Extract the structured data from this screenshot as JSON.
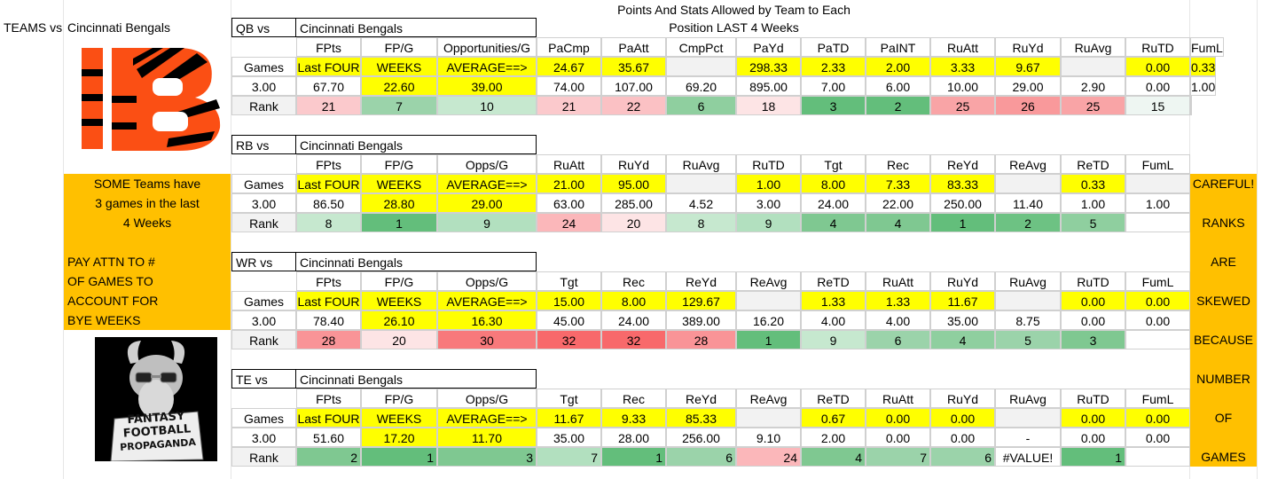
{
  "header": {
    "teams_vs": "TEAMS vs",
    "team_name": "Cincinnati Bengals",
    "title_line1": "Points And Stats Allowed by Team to Each",
    "title_line2": "Position LAST  4 Weeks"
  },
  "left_note": {
    "lines": [
      "SOME Teams have",
      "3 games in the last",
      "4 Weeks",
      "",
      "PAY ATTN TO #",
      "OF GAMES TO",
      "ACCOUNT FOR",
      "BYE WEEKS"
    ]
  },
  "right_note": {
    "words": [
      "CAREFUL!",
      "RANKS",
      "ARE",
      "SKEWED",
      "BECAUSE",
      "NUMBER",
      "OF",
      "GAMES"
    ]
  },
  "logo": {
    "bengals_logo_text": "B",
    "goat_logo_text": [
      "FANTASY",
      "FOOTBALL",
      "PROPAGANDA"
    ]
  },
  "colors": {
    "yellow": "#ffff00",
    "orange": "#ffc000",
    "bengals_orange": "#fb4f14",
    "rank_dark_green": "#63be7b",
    "rank_light_green": "#c6e8cf",
    "rank_pink": "#fbc9cc",
    "rank_red": "#f8696b"
  },
  "sections": [
    {
      "label": "QB vs",
      "team": "Cincinnati Bengals",
      "headers": [
        "FPts",
        "FP/G",
        "Opportunities/G",
        "PaCmp",
        "PaAtt",
        "CmpPct",
        "PaYd",
        "PaTD",
        "PaINT",
        "RuAtt",
        "RuYd",
        "RuAvg",
        "RuTD",
        "FumL"
      ],
      "games_label": "Games",
      "averages": [
        "Last FOUR",
        "WEEKS",
        "AVERAGE==>",
        "24.67",
        "35.67",
        "",
        "298.33",
        "2.33",
        "2.00",
        "3.33",
        "9.67",
        "",
        "0.00",
        "0.33"
      ],
      "num_games": "3.00",
      "totals": [
        "67.70",
        "22.60",
        "39.00",
        "74.00",
        "107.00",
        "69.20",
        "895.00",
        "7.00",
        "6.00",
        "10.00",
        "29.00",
        "2.90",
        "0.00",
        "1.00"
      ],
      "rank_label": "Rank",
      "ranks": [
        "21",
        "7",
        "10",
        "21",
        "22",
        "6",
        "18",
        "3",
        "2",
        "25",
        "26",
        "25",
        "15",
        ""
      ]
    },
    {
      "label": "RB vs",
      "team": "Cincinnati Bengals",
      "headers": [
        "FPts",
        "FP/G",
        "Opps/G",
        "RuAtt",
        "RuYd",
        "RuAvg",
        "RuTD",
        "Tgt",
        "Rec",
        "ReYd",
        "ReAvg",
        "ReTD",
        "FumL"
      ],
      "games_label": "Games",
      "averages": [
        "Last FOUR",
        "WEEKS",
        "AVERAGE==>",
        "21.00",
        "95.00",
        "",
        "1.00",
        "8.00",
        "7.33",
        "83.33",
        "",
        "0.33",
        ""
      ],
      "num_games": "3.00",
      "totals": [
        "86.50",
        "28.80",
        "29.00",
        "63.00",
        "285.00",
        "4.52",
        "3.00",
        "24.00",
        "22.00",
        "250.00",
        "11.40",
        "1.00",
        "1.00"
      ],
      "rank_label": "Rank",
      "ranks": [
        "8",
        "1",
        "9",
        "24",
        "20",
        "8",
        "9",
        "4",
        "4",
        "1",
        "2",
        "5",
        ""
      ]
    },
    {
      "label": "WR vs",
      "team": "Cincinnati Bengals",
      "headers": [
        "FPts",
        "FP/G",
        "Opps/G",
        "Tgt",
        "Rec",
        "ReYd",
        "ReAvg",
        "ReTD",
        "RuAtt",
        "RuYd",
        "RuAvg",
        "RuTD",
        "FumL"
      ],
      "games_label": "Games",
      "averages": [
        "Last FOUR",
        "WEEKS",
        "AVERAGE==>",
        "15.00",
        "8.00",
        "129.67",
        "",
        "1.33",
        "1.33",
        "11.67",
        "",
        "0.00",
        "0.00"
      ],
      "num_games": "3.00",
      "totals": [
        "78.40",
        "26.10",
        "16.30",
        "45.00",
        "24.00",
        "389.00",
        "16.20",
        "4.00",
        "4.00",
        "35.00",
        "8.75",
        "0.00",
        "0.00"
      ],
      "rank_label": "Rank",
      "ranks": [
        "28",
        "20",
        "30",
        "32",
        "32",
        "28",
        "1",
        "9",
        "6",
        "4",
        "5",
        "3",
        ""
      ]
    },
    {
      "label": "TE vs",
      "team": "Cincinnati Bengals",
      "headers": [
        "FPts",
        "FP/G",
        "Opps/G",
        "Tgt",
        "Rec",
        "ReYd",
        "ReAvg",
        "ReTD",
        "RuAtt",
        "RuYd",
        "RuAvg",
        "RuTD",
        "FumL"
      ],
      "games_label": "Games",
      "averages": [
        "Last FOUR",
        "WEEKS",
        "AVERAGE==>",
        "11.67",
        "9.33",
        "85.33",
        "",
        "0.67",
        "0.00",
        "0.00",
        "",
        "0.00",
        "0.00"
      ],
      "num_games": "3.00",
      "totals": [
        "51.60",
        "17.20",
        "11.70",
        "35.00",
        "28.00",
        "256.00",
        "9.10",
        "2.00",
        "0.00",
        "0.00",
        "-",
        "0.00",
        "0.00"
      ],
      "rank_label": "Rank",
      "ranks": [
        "2",
        "1",
        "3",
        "7",
        "1",
        "6",
        "24",
        "4",
        "7",
        "6",
        "#VALUE!",
        "1",
        ""
      ]
    }
  ]
}
